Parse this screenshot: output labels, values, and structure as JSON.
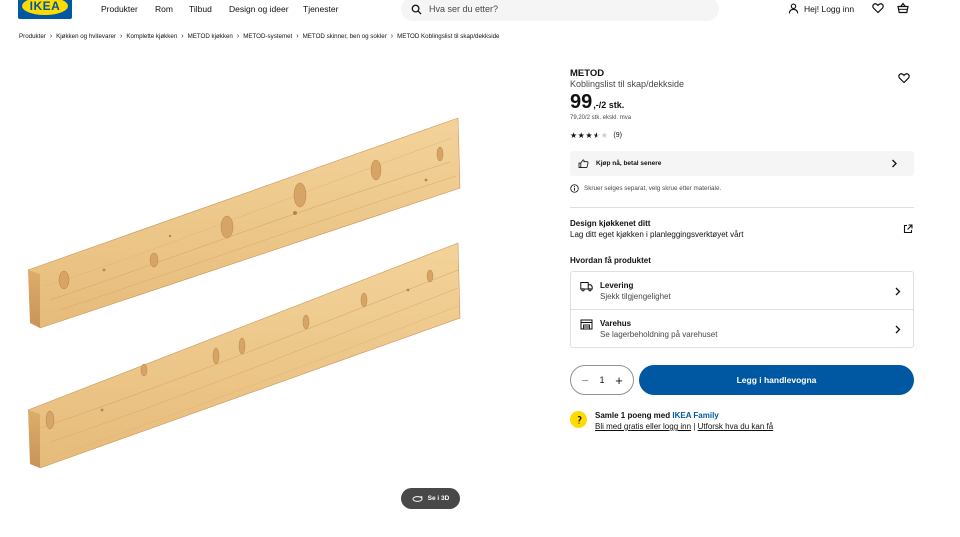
{
  "header": {
    "logo_text": "IKEA",
    "nav": [
      "Produkter",
      "Rom",
      "Tilbud",
      "Design og ideer",
      "Tjenester"
    ],
    "search_placeholder": "Hva ser du etter?",
    "login_label": "Hej! Logg inn",
    "icons": [
      "search-icon",
      "user-icon",
      "heart-icon",
      "cart-icon"
    ]
  },
  "breadcrumb": [
    "Produkter",
    "Kjøkken og hvitevarer",
    "Komplette kjøkken",
    "METOD kjøkken",
    "METOD-systemet",
    "METOD skinner, ben og sokler",
    "METOD Koblingslist til skap/dekkside"
  ],
  "product": {
    "name": "METOD",
    "description": "Koblingslist til skap/dekkside",
    "price_int": "99",
    "price_dec": ",-",
    "price_unit": "/2 stk.",
    "price_ex_vat": "79,20/2 stk. ekskl. mva",
    "rating_stars": 3.5,
    "rating_count": "(9)",
    "see_3d_label": "Se i 3D"
  },
  "bnpl_label": "Kjøp nå, betal senere",
  "screw_note": "Skruer selges separat, velg skrue etter materiale.",
  "design": {
    "title": "Design kjøkkenet ditt",
    "subtitle": "Lag ditt eget kjøkken i planleggingsverktøyet vårt"
  },
  "delivery": {
    "heading": "Hvordan få produktet",
    "options": [
      {
        "title": "Levering",
        "subtitle": "Sjekk tilgjengelighet"
      },
      {
        "title": "Varehus",
        "subtitle": "Se lagerbeholdning på varehuset"
      }
    ]
  },
  "quantity": "1",
  "add_to_cart_label": "Legg i handlevogna",
  "family": {
    "title_prefix": "Samle 1 poeng med ",
    "brand": "IKEA Family",
    "link1": "Bli med gratis eller logg inn",
    "separator": "|",
    "link2": "Utforsk hva du kan få"
  },
  "colors": {
    "brand_blue": "#0058a3",
    "brand_yellow": "#ffdb00"
  }
}
